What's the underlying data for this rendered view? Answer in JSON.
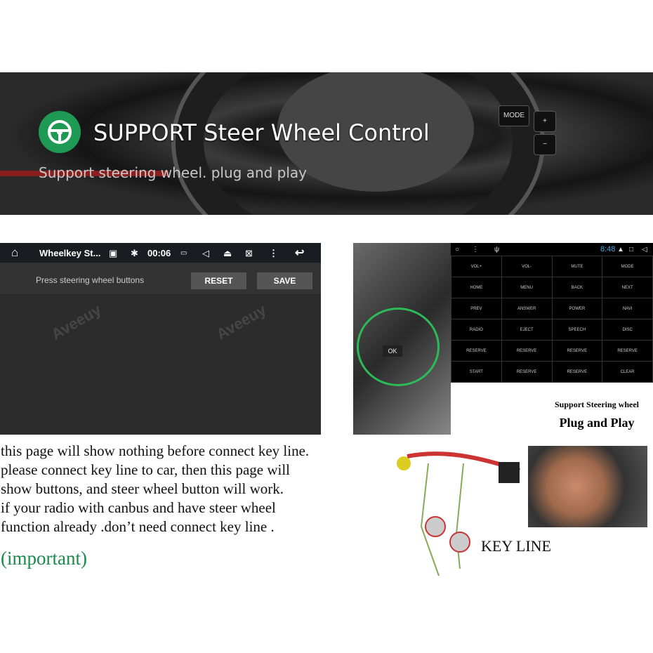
{
  "banner": {
    "title": "SUPPORT Steer Wheel Control",
    "subtitle": "Support steering wheel. plug and play",
    "wheel_buttons": [
      "MODE",
      "+",
      "−"
    ]
  },
  "app_screen": {
    "title": "Wheelkey St...",
    "time": "00:06",
    "instruction": "Press steering wheel buttons",
    "reset_label": "RESET",
    "save_label": "SAVE",
    "watermark": "Aveeuy"
  },
  "key_grid": {
    "time": "8:48",
    "time_color": "#4aa8e0",
    "rows": [
      [
        "VOL+",
        "VOL-",
        "MUTE",
        "MODE"
      ],
      [
        "HOME",
        "MENU",
        "BACK",
        "NEXT"
      ],
      [
        "PREV",
        "ANSWER",
        "POWER",
        "NAVI"
      ],
      [
        "RADIO",
        "EJECT",
        "SPEECH",
        "DISC"
      ],
      [
        "RESERVE",
        "RESERVE",
        "RESERVE",
        "RESERVE"
      ],
      [
        "START",
        "RESERVE",
        "RESERVE",
        "CLEAR"
      ]
    ]
  },
  "plug_play": {
    "line1": "Support Steering wheel",
    "line2": "Plug and Play"
  },
  "notes": [
    "this page will show nothing before connect key line.",
    "please connect key line to car, then this page will",
    "show buttons, and steer wheel button will work.",
    "if your radio with canbus and have steer wheel",
    "function already .don’t need connect key line ."
  ],
  "important": "(important)",
  "important_color": "#1a8a4a",
  "key_line_label": "KEY LINE",
  "steering_ok_label": "OK"
}
